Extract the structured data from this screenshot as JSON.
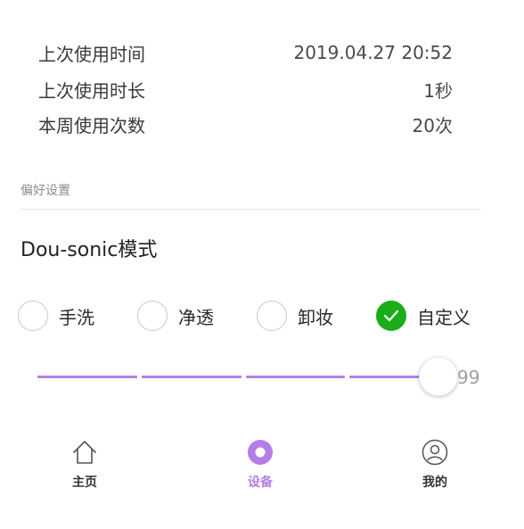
{
  "stats": [
    {
      "label": "上次使用时间",
      "value": "2019.04.27 20:52"
    },
    {
      "label": "上次使用时长",
      "value": "1秒"
    },
    {
      "label": "本周使用次数",
      "value": "20次"
    }
  ],
  "preferences": {
    "section_label": "偏好设置",
    "mode_title": "Dou-sonic模式",
    "options": [
      {
        "label": "手洗",
        "checked": false
      },
      {
        "label": "净透",
        "checked": false
      },
      {
        "label": "卸妆",
        "checked": false
      },
      {
        "label": "自定义",
        "checked": true
      }
    ],
    "slider": {
      "value": "99",
      "max": 100
    },
    "accent_color": "#b57ee6",
    "checked_color": "#1aad19"
  },
  "tabbar": {
    "tabs": [
      {
        "label": "主页",
        "icon": "home-icon",
        "active": false
      },
      {
        "label": "设备",
        "icon": "device-icon",
        "active": true
      },
      {
        "label": "我的",
        "icon": "profile-icon",
        "active": false
      }
    ]
  }
}
